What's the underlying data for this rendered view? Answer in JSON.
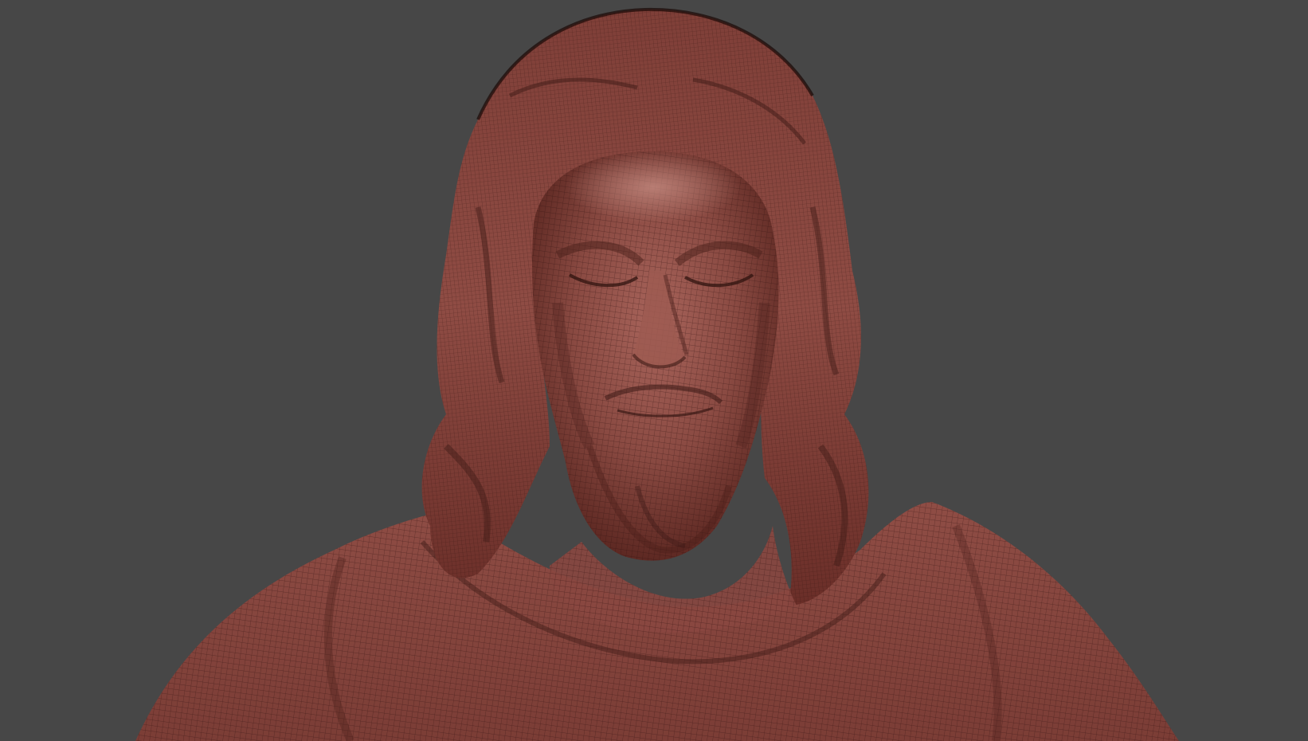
{
  "viewport": {
    "background_color": "#474747",
    "render_mode": "wireframe-on-shaded",
    "model": {
      "subject": "bust-sculpture",
      "surface_color": "#8a4740",
      "shadow_color": "#3d1a16",
      "highlight_color": "#b87a70",
      "wire_color": "#2a0f0c"
    }
  }
}
